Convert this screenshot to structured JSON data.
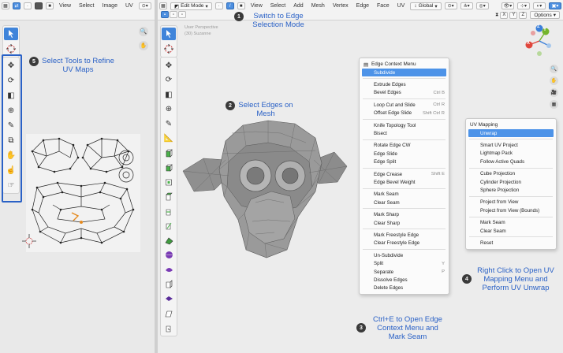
{
  "uv_editor": {
    "header": {
      "menus": [
        "View",
        "Select",
        "Image",
        "UV"
      ]
    }
  },
  "viewport": {
    "header": {
      "mode": "Edit Mode",
      "menus": [
        "View",
        "Select",
        "Add",
        "Mesh",
        "Vertex",
        "Edge",
        "Face",
        "UV"
      ],
      "transform_orientation": "Global",
      "axes": [
        "X",
        "Y",
        "Z"
      ],
      "options_label": "Options"
    },
    "overlay_text": [
      "User Perspective",
      "(30) Suzanne"
    ],
    "gizmo_axes": {
      "x": "X",
      "y": "Y",
      "z": "Z"
    }
  },
  "callouts": [
    {
      "number": "1",
      "text": "Switch to Edge Selection Mode"
    },
    {
      "number": "2",
      "text": "Select Edges on Mesh"
    },
    {
      "number": "3",
      "text": "Ctrl+E to Open Edge Context Menu and Mark Seam"
    },
    {
      "number": "4",
      "text": "Right Click to Open UV Mapping Menu and Perform UV Unwrap"
    },
    {
      "number": "5",
      "text": "Select Tools to Refine UV Maps"
    }
  ],
  "edge_menu": {
    "title": "Edge Context Menu",
    "items": [
      {
        "label": "Subdivide",
        "shortcut": "",
        "highlight": true
      },
      {
        "sep": true
      },
      {
        "label": "Extrude Edges",
        "shortcut": ""
      },
      {
        "label": "Bevel Edges",
        "shortcut": "Ctrl B"
      },
      {
        "sep": true
      },
      {
        "label": "Loop Cut and Slide",
        "shortcut": "Ctrl R"
      },
      {
        "label": "Offset Edge Slide",
        "shortcut": "Shift Ctrl R"
      },
      {
        "sep": true
      },
      {
        "label": "Knife Topology Tool",
        "shortcut": ""
      },
      {
        "label": "Bisect",
        "shortcut": ""
      },
      {
        "sep": true
      },
      {
        "label": "Rotate Edge CW",
        "shortcut": ""
      },
      {
        "label": "Edge Slide",
        "shortcut": ""
      },
      {
        "label": "Edge Split",
        "shortcut": ""
      },
      {
        "sep": true
      },
      {
        "label": "Edge Crease",
        "shortcut": "Shift E"
      },
      {
        "label": "Edge Bevel Weight",
        "shortcut": ""
      },
      {
        "sep": true
      },
      {
        "label": "Mark Seam",
        "shortcut": ""
      },
      {
        "label": "Clear Seam",
        "shortcut": ""
      },
      {
        "sep": true
      },
      {
        "label": "Mark Sharp",
        "shortcut": ""
      },
      {
        "label": "Clear Sharp",
        "shortcut": ""
      },
      {
        "sep": true
      },
      {
        "label": "Mark Freestyle Edge",
        "shortcut": ""
      },
      {
        "label": "Clear Freestyle Edge",
        "shortcut": ""
      },
      {
        "sep": true
      },
      {
        "label": "Un-Subdivide",
        "shortcut": ""
      },
      {
        "label": "Split",
        "shortcut": "Y"
      },
      {
        "label": "Separate",
        "shortcut": "P"
      },
      {
        "label": "Dissolve Edges",
        "shortcut": ""
      },
      {
        "label": "Delete Edges",
        "shortcut": ""
      }
    ]
  },
  "uv_menu": {
    "title": "UV Mapping",
    "items": [
      {
        "label": "Unwrap",
        "highlight": true
      },
      {
        "sep": true
      },
      {
        "label": "Smart UV Project"
      },
      {
        "label": "Lightmap Pack"
      },
      {
        "label": "Follow Active Quads"
      },
      {
        "sep": true
      },
      {
        "label": "Cube Projection"
      },
      {
        "label": "Cylinder Projection"
      },
      {
        "label": "Sphere Projection"
      },
      {
        "sep": true
      },
      {
        "label": "Project from View"
      },
      {
        "label": "Project from View (Bounds)"
      },
      {
        "sep": true
      },
      {
        "label": "Mark Seam"
      },
      {
        "label": "Clear Seam"
      },
      {
        "sep": true
      },
      {
        "label": "Reset"
      }
    ]
  },
  "colors": {
    "accent": "#4d93e8",
    "callout_text": "#2a61c6",
    "axis_x": "#e0463c",
    "axis_y": "#74b52c",
    "axis_z": "#3b7fd9",
    "mesh": "#8a8a8a"
  }
}
